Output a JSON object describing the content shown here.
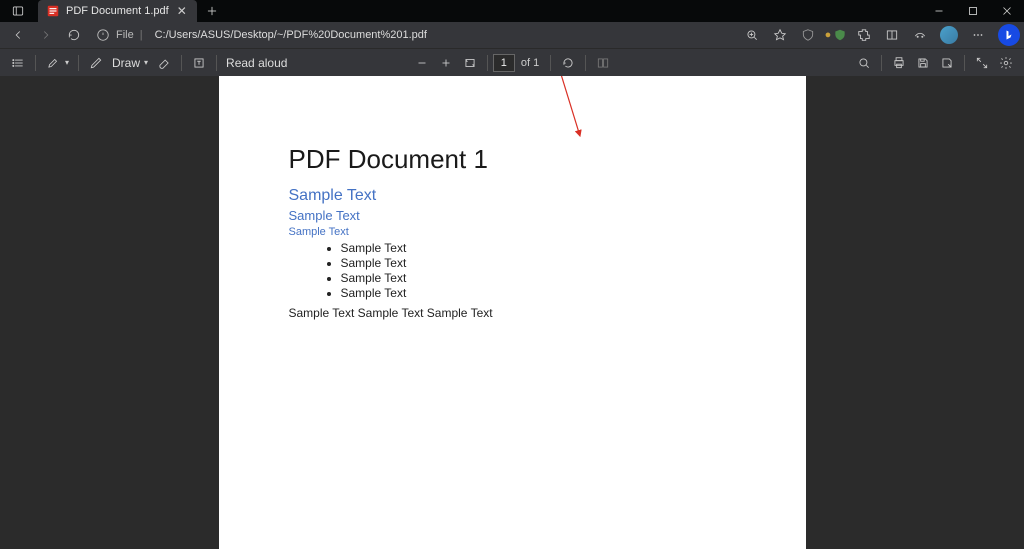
{
  "tab": {
    "title": "PDF Document 1.pdf"
  },
  "address": {
    "scheme": "File",
    "path": "C:/Users/ASUS/Desktop/~/PDF%20Document%201.pdf"
  },
  "pdfbar": {
    "draw_label": "Draw",
    "read_aloud": "Read aloud",
    "page_current": "1",
    "page_total_prefix": "of",
    "page_total": "1"
  },
  "document": {
    "title": "PDF Document 1",
    "h1": "Sample Text",
    "h2": "Sample Text",
    "h3": "Sample Text",
    "bullets": [
      "Sample Text",
      "Sample Text",
      "Sample Text",
      "Sample Text"
    ],
    "paragraph": "Sample Text Sample Text Sample Text"
  }
}
